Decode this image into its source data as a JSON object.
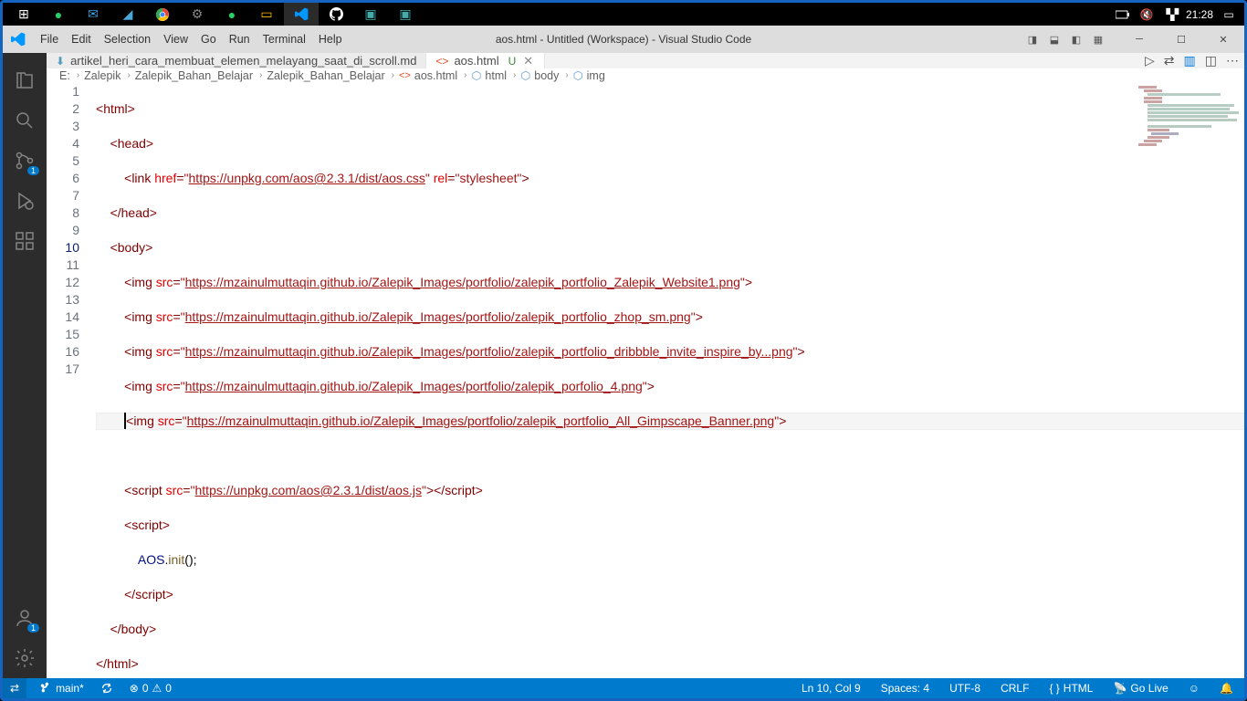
{
  "taskbar": {
    "clock": "21:28"
  },
  "titlebar": {
    "title": "aos.html - Untitled (Workspace) - Visual Studio Code",
    "menus": [
      "File",
      "Edit",
      "Selection",
      "View",
      "Go",
      "Run",
      "Terminal",
      "Help"
    ]
  },
  "activity": {
    "scm_badge": "1",
    "account_badge": "1"
  },
  "tabs": {
    "tab1": {
      "label": "artikel_heri_cara_membuat_elemen_melayang_saat_di_scroll.md"
    },
    "tab2": {
      "label": "aos.html",
      "status": "U"
    }
  },
  "breadcrumb": {
    "p1": "E:",
    "p2": "Zalepik",
    "p3": "Zalepik_Bahan_Belajar",
    "p4": "Zalepik_Bahan_Belajar",
    "p5": "aos.html",
    "p6": "html",
    "p7": "body",
    "p8": "img"
  },
  "code": {
    "l1_open": "<html>",
    "l2_open": "<head>",
    "l3_tag": "link",
    "l3_a1": "href",
    "l3_v1": "https://unpkg.com/aos@2.3.1/dist/aos.css",
    "l3_a2": "rel",
    "l3_v2": "stylesheet",
    "l4_close": "</head>",
    "l5_open": "<body>",
    "l6_tag": "img",
    "l6_a": "src",
    "l6_v": "https://mzainulmuttaqin.github.io/Zalepik_Images/portfolio/zalepik_portfolio_Zalepik_Website1.png",
    "l7_v": "https://mzainulmuttaqin.github.io/Zalepik_Images/portfolio/zalepik_portfolio_zhop_sm.png",
    "l8_v": "https://mzainulmuttaqin.github.io/Zalepik_Images/portfolio/zalepik_portfolio_dribbble_invite_inspire_by...png",
    "l9_v": "https://mzainulmuttaqin.github.io/Zalepik_Images/portfolio/zalepik_porfolio_4.png",
    "l10_v": "https://mzainulmuttaqin.github.io/Zalepik_Images/portfolio/zalepik_portfolio_All_Gimpscape_Banner.png",
    "l12_tag": "script",
    "l12_a": "src",
    "l12_v": "https://unpkg.com/aos@2.3.1/dist/aos.js",
    "l13_open": "<script>",
    "l14_obj": "AOS",
    "l14_meth": "init",
    "l15_close": "</script>",
    "l16_close": "</body>",
    "l17_close": "</html>"
  },
  "lines": [
    "1",
    "2",
    "3",
    "4",
    "5",
    "6",
    "7",
    "8",
    "9",
    "10",
    "11",
    "12",
    "13",
    "14",
    "15",
    "16",
    "17"
  ],
  "status": {
    "branch": "main*",
    "errors": "0",
    "warnings": "0",
    "lncol": "Ln 10, Col 9",
    "spaces": "Spaces: 4",
    "encoding": "UTF-8",
    "eol": "CRLF",
    "lang": "HTML",
    "golive": "Go Live"
  }
}
